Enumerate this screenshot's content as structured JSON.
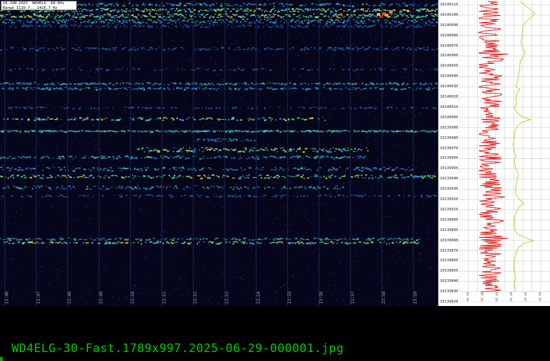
{
  "info": {
    "line1": "29-JUN-2025  WD4ELG  00:00z",
    "line2": "Range 1110.7...1416.7 Hz"
  },
  "time_ticks": [
    "23:46",
    "23:47",
    "23:48",
    "23:49",
    "23:50",
    "23:51",
    "23:52",
    "23:53",
    "23:54",
    "23:55",
    "23:56",
    "23:57",
    "23:58",
    "23:59"
  ],
  "freq_labels": [
    "10140110",
    "10140100",
    "10140090",
    "10140080",
    "10140070",
    "10140060",
    "10140050",
    "10140040",
    "10140030",
    "10140020",
    "10140010",
    "10140000",
    "10139990",
    "10139980",
    "10139970",
    "10139960",
    "10139950",
    "10139940",
    "10139930",
    "10139920",
    "10139910",
    "10139900",
    "10139890",
    "10139880",
    "10139870",
    "10139860",
    "10139850",
    "10139840",
    "10139830",
    "10139820"
  ],
  "spectrum_ticks": [
    "-60 dB",
    "-50 dB",
    "-40 dB",
    "-30 dB",
    "-20 dB",
    "-10 dB"
  ],
  "filename": "WD4ELG-30-Fast.1789x997.2025-06-29-000001.jpg",
  "colors": {
    "trace_red": "#e01010",
    "trace_yellow": "#c8c832",
    "filename_green": "#00cc00"
  }
}
